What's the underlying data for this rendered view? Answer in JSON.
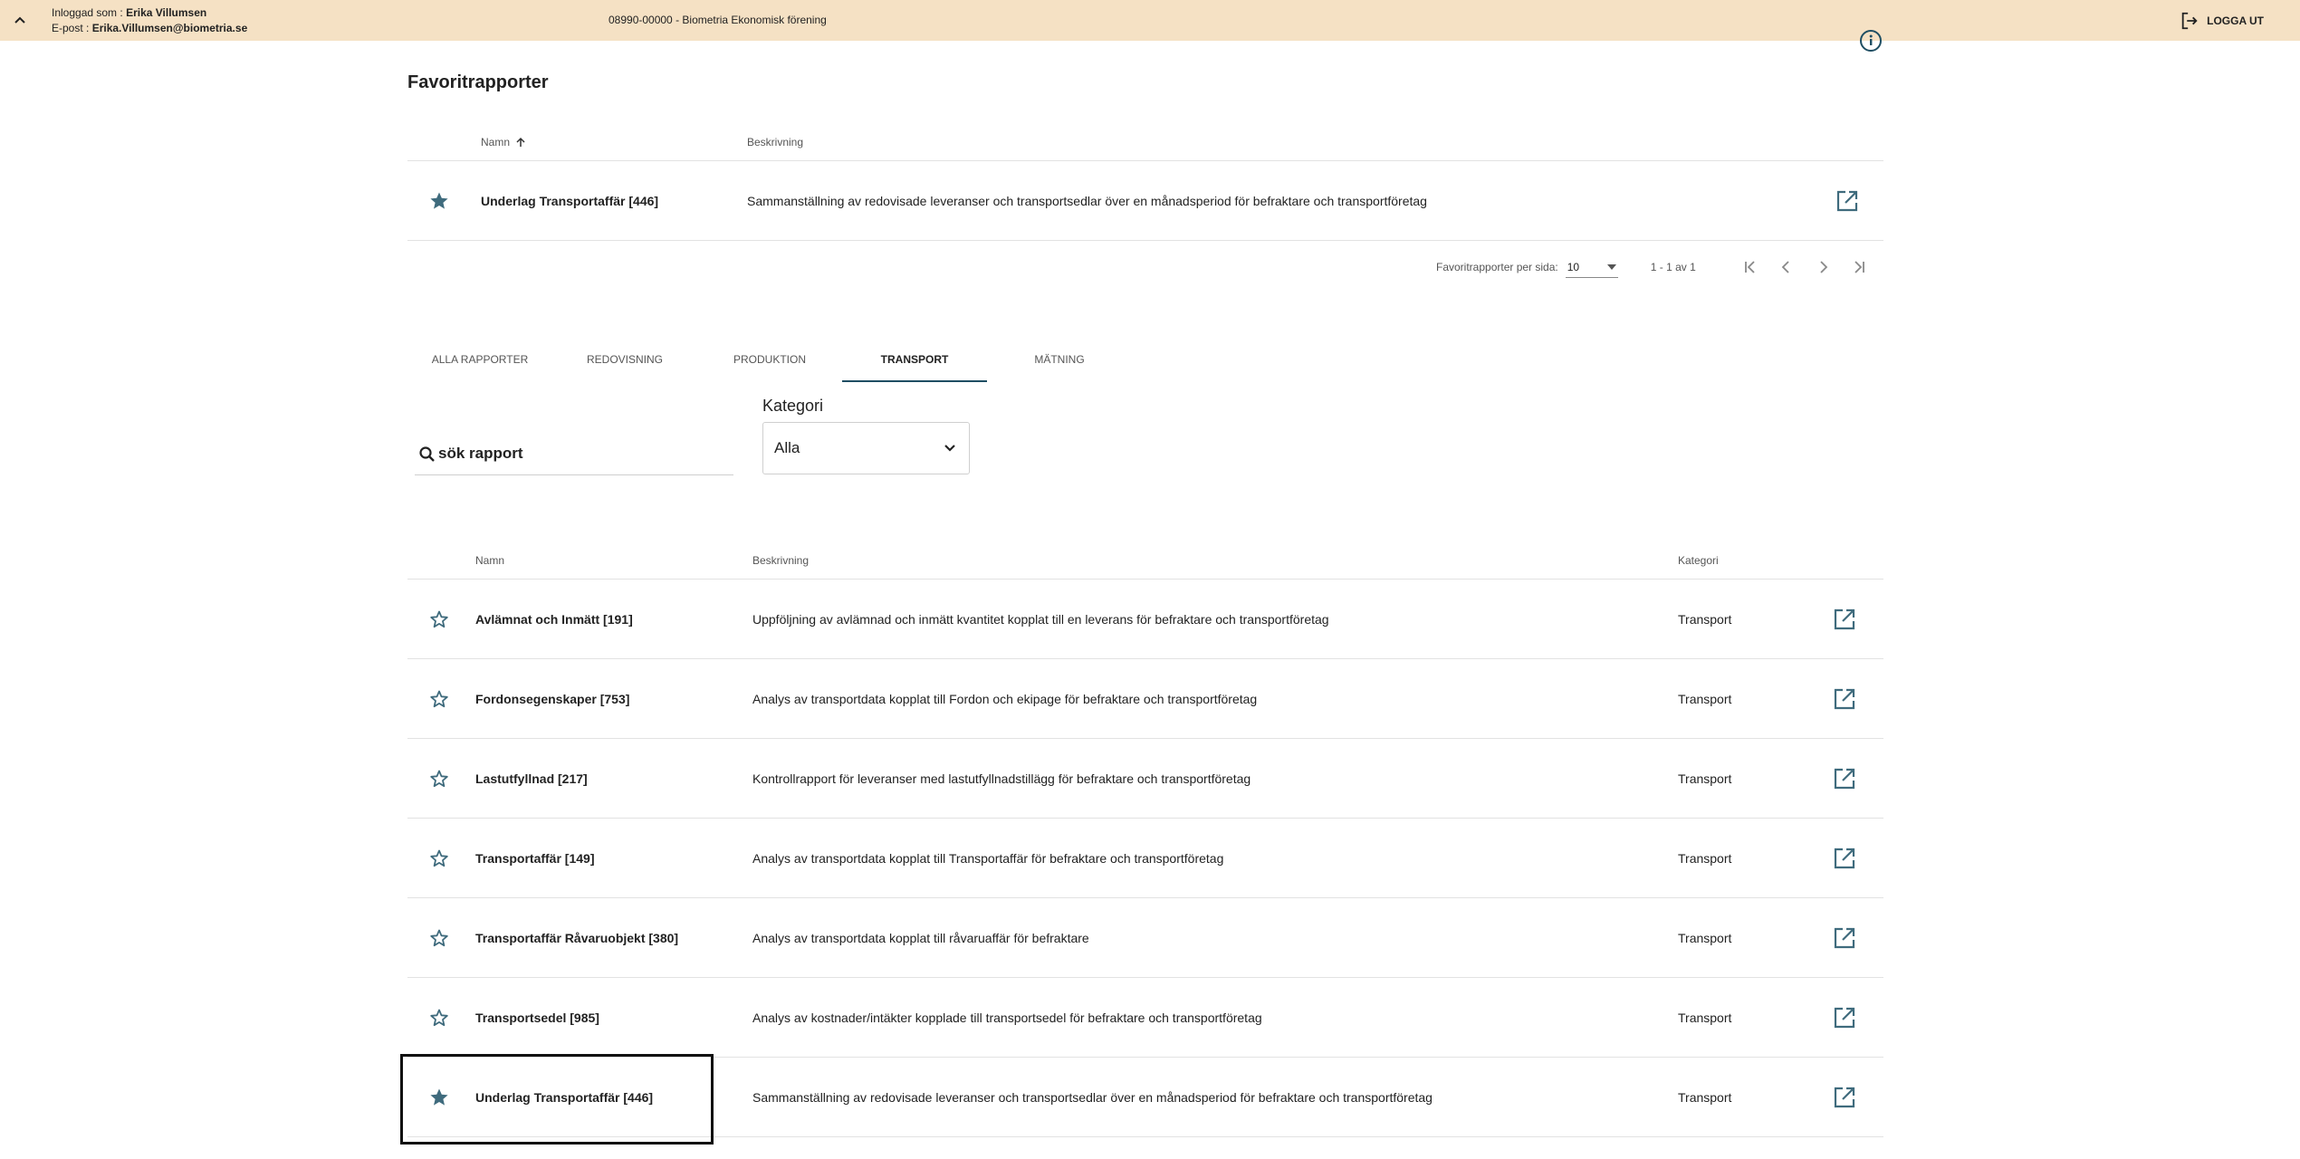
{
  "topbar": {
    "logged_in_label": "Inloggad som : ",
    "user_name": "Erika Villumsen",
    "email_label": "E-post : ",
    "email": "Erika.Villumsen@biometria.se",
    "organization": "08990-00000 - Biometria Ekonomisk förening",
    "logout_label": "LOGGA UT"
  },
  "favorites": {
    "title": "Favoritrapporter",
    "columns": {
      "name": "Namn",
      "description": "Beskrivning"
    },
    "rows": [
      {
        "name": "Underlag Transportaffär [446]",
        "description": "Sammanställning av redovisade leveranser och transportsedlar över en månadsperiod för befraktare och transportföretag",
        "starred": true
      }
    ],
    "paginator": {
      "per_page_label": "Favoritrapporter per sida:",
      "per_page_value": "10",
      "range": "1 - 1 av 1"
    }
  },
  "tabs": [
    {
      "label": "ALLA RAPPORTER",
      "active": false
    },
    {
      "label": "REDOVISNING",
      "active": false
    },
    {
      "label": "PRODUKTION",
      "active": false
    },
    {
      "label": "TRANSPORT",
      "active": true
    },
    {
      "label": "MÄTNING",
      "active": false
    }
  ],
  "search": {
    "placeholder": "sök rapport"
  },
  "category_filter": {
    "label": "Kategori",
    "value": "Alla"
  },
  "reports": {
    "columns": {
      "name": "Namn",
      "description": "Beskrivning",
      "category": "Kategori"
    },
    "rows": [
      {
        "name": "Avlämnat och Inmätt [191]",
        "description": "Uppföljning av avlämnad och inmätt kvantitet kopplat till en leverans för befraktare och transportföretag",
        "category": "Transport",
        "starred": false
      },
      {
        "name": "Fordonsegenskaper [753]",
        "description": "Analys av transportdata kopplat till Fordon och ekipage för befraktare och transportföretag",
        "category": "Transport",
        "starred": false
      },
      {
        "name": "Lastutfyllnad [217]",
        "description": "Kontrollrapport för leveranser med lastutfyllnadstillägg för befraktare och transportföretag",
        "category": "Transport",
        "starred": false
      },
      {
        "name": "Transportaffär [149]",
        "description": "Analys av transportdata kopplat till Transportaffär för befraktare och transportföretag",
        "category": "Transport",
        "starred": false
      },
      {
        "name": "Transportaffär Råvaruobjekt [380]",
        "description": "Analys av transportdata kopplat till råvaruaffär för befraktare",
        "category": "Transport",
        "starred": false
      },
      {
        "name": "Transportsedel [985]",
        "description": "Analys av kostnader/intäkter kopplade till transportsedel för befraktare och transportföretag",
        "category": "Transport",
        "starred": false
      },
      {
        "name": "Underlag Transportaffär [446]",
        "description": "Sammanställning av redovisade leveranser och transportsedlar över en månadsperiod för befraktare och transportföretag",
        "category": "Transport",
        "starred": true
      }
    ]
  },
  "colors": {
    "accent": "#3f6b7d",
    "topbar_bg": "#f5e1c4",
    "tab_indicator": "#1f4e63"
  },
  "icons": {
    "collapse": "chevron-up-icon",
    "logout": "logout-icon",
    "help": "info-icon",
    "sort": "arrow-up-icon",
    "star_filled": "star-filled-icon",
    "star_outline": "star-outline-icon",
    "open": "open-in-new-icon",
    "search": "search-icon",
    "dropdown": "chevron-down-icon"
  }
}
